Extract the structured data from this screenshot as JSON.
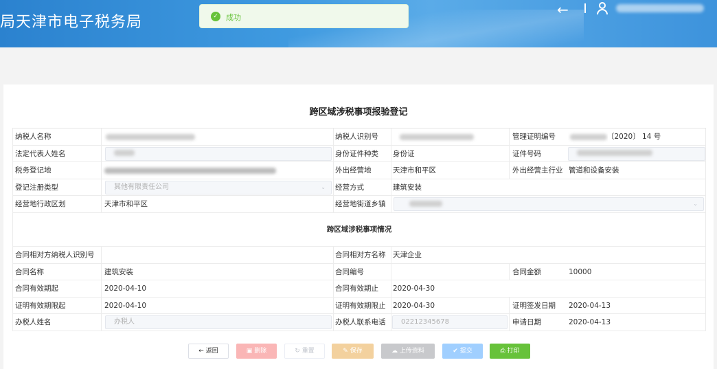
{
  "header": {
    "title": "局天津市电子税务局",
    "toast": "成功"
  },
  "page_title": "跨区域涉税事项报验登记",
  "section_title": "跨区域涉税事项情况",
  "fields": {
    "taxpayer_name_label": "纳税人名称",
    "taxpayer_id_label": "纳税人识别号",
    "cert_no_label": "管理证明编号",
    "cert_no_value": "〔2020〕 14 号",
    "legal_rep_label": "法定代表人姓名",
    "id_type_label": "身份证件种类",
    "id_type_value": "身份证",
    "id_no_label": "证件号码",
    "tax_office_label": "税务登记地",
    "out_place_label": "外出经营地",
    "out_place_value": "天津市和平区",
    "out_industry_label": "外出经营主行业",
    "out_industry_value": "管道和设备安装",
    "reg_type_label": "登记注册类型",
    "reg_type_value": "其他有限责任公司",
    "biz_mode_label": "经营方式",
    "biz_mode_value": "建筑安装",
    "biz_area_label": "经营地行政区划",
    "biz_area_value": "天津市和平区",
    "biz_street_label": "经营地街道乡镇",
    "counter_id_label": "合同相对方纳税人识别号",
    "counter_name_label": "合同相对方名称",
    "counter_name_value": "天津企业",
    "contract_name_label": "合同名称",
    "contract_name_value": "建筑安装",
    "contract_no_label": "合同编号",
    "contract_amount_label": "合同金额",
    "contract_amount_value": "10000",
    "contract_start_label": "合同有效期起",
    "contract_start_value": "2020-04-10",
    "contract_end_label": "合同有效期止",
    "contract_end_value": "2020-04-30",
    "cert_start_label": "证明有效期限起",
    "cert_start_value": "2020-04-10",
    "cert_end_label": "证明有效期限止",
    "cert_end_value": "2020-04-30",
    "issue_date_label": "证明签发日期",
    "issue_date_value": "2020-04-13",
    "handler_label": "办税人姓名",
    "handler_placeholder": "办税人",
    "phone_label": "办税人联系电话",
    "phone_value": "02212345678",
    "apply_date_label": "申请日期",
    "apply_date_value": "2020-04-13"
  },
  "buttons": {
    "back": "返回",
    "delete": "删除",
    "reset": "重置",
    "save": "保存",
    "upload": "上传资料",
    "submit": "提交",
    "print": "打印"
  },
  "colors": {
    "header_blue": "#3f9ae0",
    "success": "#67c23a",
    "danger": "#f56c6c",
    "warning": "#e6a23c",
    "info": "#909399",
    "primary": "#409eff"
  },
  "icons": {
    "back": "arrow-left-icon",
    "user": "user-icon",
    "success": "check-circle-icon"
  }
}
